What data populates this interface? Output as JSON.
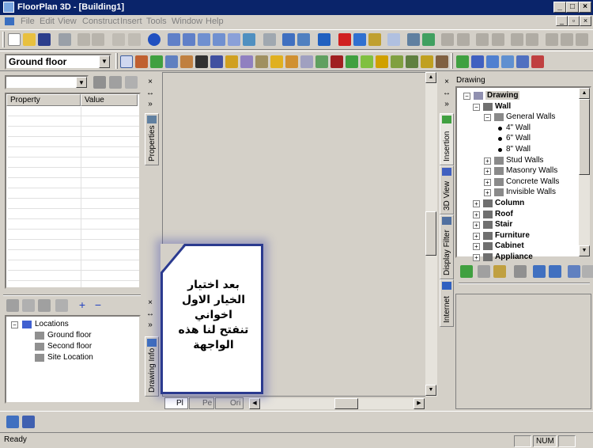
{
  "window": {
    "title": "FloorPlan 3D - [Building1]"
  },
  "menu": {
    "items": [
      "File",
      "Edit",
      "View",
      "Construct",
      "Insert",
      "Tools",
      "Window",
      "Help"
    ]
  },
  "level_combo": {
    "value": "Ground floor"
  },
  "properties": {
    "col_property": "Property",
    "col_value": "Value",
    "tab_label": "Properties"
  },
  "drawing_info": {
    "tab_label": "Drawing Info",
    "tree": [
      {
        "label": "Locations",
        "level": 0
      },
      {
        "label": "Ground floor",
        "level": 1
      },
      {
        "label": "Second floor",
        "level": 1
      },
      {
        "label": "Site Location",
        "level": 1
      }
    ]
  },
  "bottom_tabs": [
    "Pl",
    "Pe",
    "Ori"
  ],
  "note": {
    "text_lines": [
      "بعد اختيار",
      "الخيار الاول",
      "اخواني",
      "تنفتح لنا هذه",
      "الواجهة"
    ]
  },
  "right_panel": {
    "header": "Drawing",
    "side_tabs": [
      "Insertion",
      "3D View",
      "Display Filter",
      "Internet"
    ],
    "tree": [
      {
        "label": "Drawing",
        "level": 0,
        "bold": true,
        "expander": "-"
      },
      {
        "label": "Wall",
        "level": 1,
        "bold": true,
        "expander": "-"
      },
      {
        "label": "General Walls",
        "level": 2,
        "bold": false,
        "expander": "-"
      },
      {
        "label": "4\" Wall",
        "level": 3,
        "bold": false,
        "expander": ""
      },
      {
        "label": "6\" Wall",
        "level": 3,
        "bold": false,
        "expander": ""
      },
      {
        "label": "8\" Wall",
        "level": 3,
        "bold": false,
        "expander": ""
      },
      {
        "label": "Stud Walls",
        "level": 2,
        "bold": false,
        "expander": "+"
      },
      {
        "label": "Masonry Walls",
        "level": 2,
        "bold": false,
        "expander": "+"
      },
      {
        "label": "Concrete Walls",
        "level": 2,
        "bold": false,
        "expander": "+"
      },
      {
        "label": "Invisible Walls",
        "level": 2,
        "bold": false,
        "expander": "+"
      },
      {
        "label": "Column",
        "level": 1,
        "bold": true,
        "expander": "+"
      },
      {
        "label": "Roof",
        "level": 1,
        "bold": true,
        "expander": "+"
      },
      {
        "label": "Stair",
        "level": 1,
        "bold": true,
        "expander": "+"
      },
      {
        "label": "Furniture",
        "level": 1,
        "bold": true,
        "expander": "+"
      },
      {
        "label": "Cabinet",
        "level": 1,
        "bold": true,
        "expander": "+"
      },
      {
        "label": "Appliance",
        "level": 1,
        "bold": true,
        "expander": "+"
      }
    ]
  },
  "status": {
    "text": "Ready",
    "num": "NUM"
  }
}
